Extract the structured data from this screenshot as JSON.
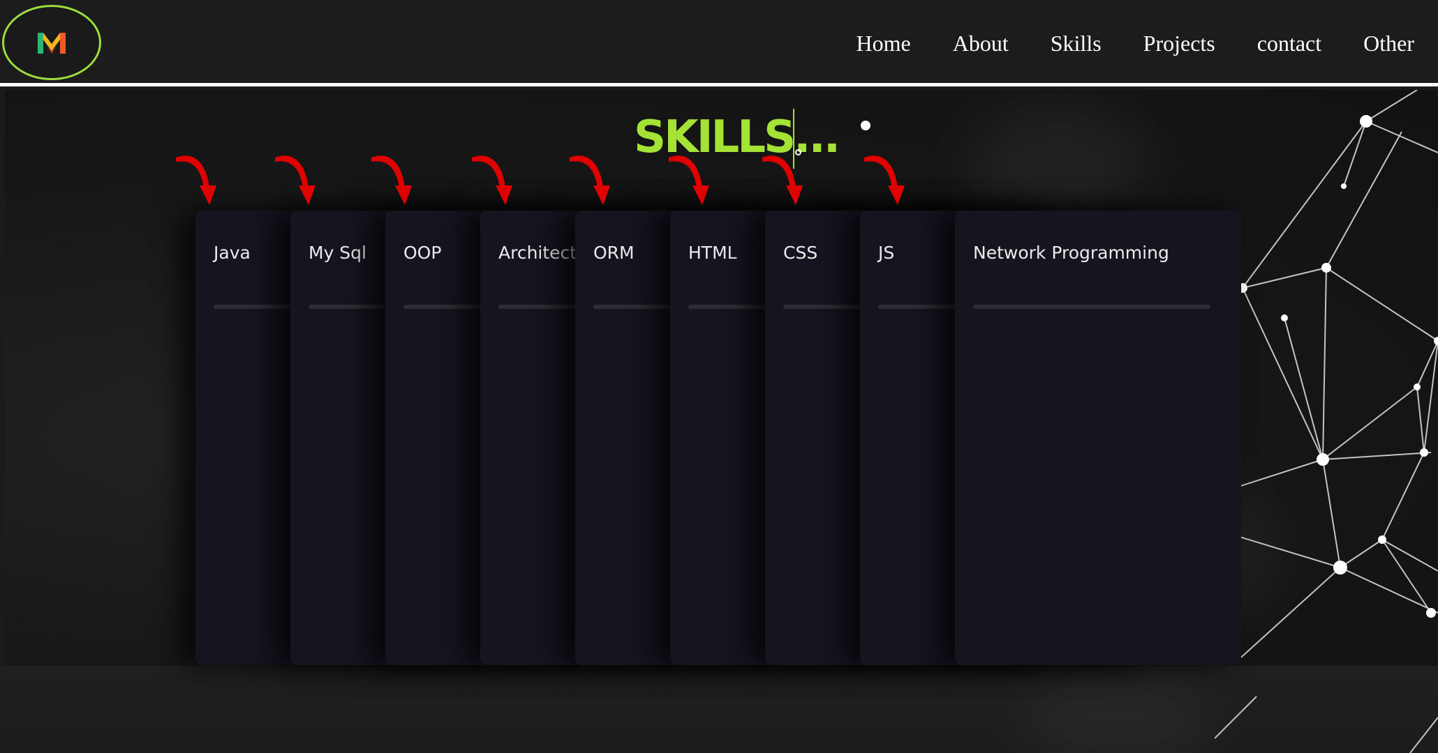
{
  "nav": {
    "links": [
      "Home",
      "About",
      "Skills",
      "Projects",
      "contact",
      "Other"
    ]
  },
  "skills": {
    "title": "SKILLS...",
    "cards": [
      "Java",
      "My Sql",
      "OOP",
      "Architectu",
      "ORM",
      "HTML",
      "CSS",
      "JS",
      "Network  Programming"
    ]
  },
  "colors": {
    "accent": "#a4e336",
    "logo_ring": "#9bde3c",
    "card_bg": "#16141f",
    "arrow": "#e00000",
    "background": "#1b1b1b"
  },
  "icons": {
    "logo": "m-logo-icon",
    "arrow": "curved-arrow-down-icon"
  }
}
